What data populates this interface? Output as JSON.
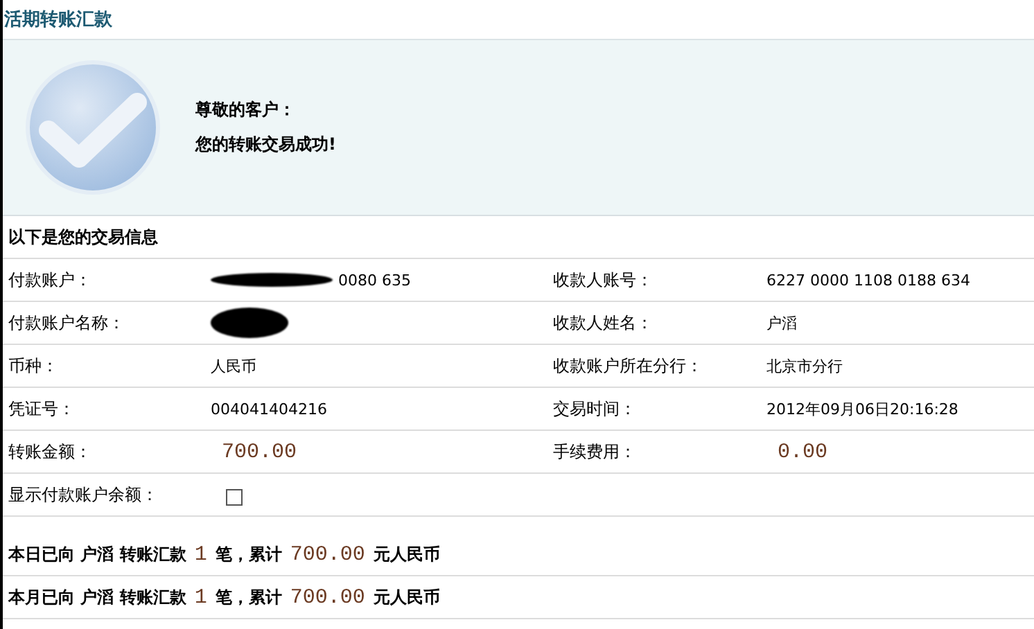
{
  "page_title": "活期转账汇款",
  "success": {
    "greeting": "尊敬的客户：",
    "message": "您的转账交易成功!"
  },
  "section_title": "以下是您的交易信息",
  "rows": [
    {
      "label": "付款账户：",
      "value": [
        {
          "kind": "redacted"
        },
        {
          "kind": "text",
          "text": "0080 635"
        }
      ],
      "label2": "收款人账号：",
      "value2": [
        {
          "kind": "text",
          "text": "6227 0000 1108 0188 634"
        }
      ]
    },
    {
      "label": "付款账户名称：",
      "value": [
        {
          "kind": "redacted"
        }
      ],
      "label2": "收款人姓名：",
      "value2": [
        {
          "kind": "text",
          "text": "户滔"
        }
      ]
    },
    {
      "label": "币种：",
      "value": [
        {
          "kind": "text",
          "text": "人民币"
        }
      ],
      "label2": "收款账户所在分行：",
      "value2": [
        {
          "kind": "text",
          "text": "北京市分行"
        }
      ]
    },
    {
      "label": "凭证号：",
      "value": [
        {
          "kind": "text",
          "text": "004041404216"
        }
      ],
      "label2": "交易时间：",
      "value2": [
        {
          "kind": "text",
          "text": "2012年09月06日20:16:28"
        }
      ]
    },
    {
      "label": "转账金额：",
      "value": [
        {
          "kind": "amount",
          "text": "700.00"
        }
      ],
      "label2": "手续费用：",
      "value2": [
        {
          "kind": "amount",
          "text": "0.00"
        }
      ]
    }
  ],
  "balance_option": {
    "label": "显示付款账户余额：",
    "checked": false
  },
  "summaries": [
    {
      "parts": [
        {
          "kind": "text",
          "text": "本日已向 户滔 转账汇款"
        },
        {
          "kind": "number",
          "text": "1"
        },
        {
          "kind": "text",
          "text": "笔，累计"
        },
        {
          "kind": "number",
          "text": "700.00"
        },
        {
          "kind": "text",
          "text": "元人民币"
        }
      ]
    },
    {
      "parts": [
        {
          "kind": "text",
          "text": "本月已向 户滔 转账汇款"
        },
        {
          "kind": "number",
          "text": "1"
        },
        {
          "kind": "text",
          "text": "笔，累计"
        },
        {
          "kind": "number",
          "text": "700.00"
        },
        {
          "kind": "text",
          "text": "元人民币"
        }
      ]
    }
  ]
}
